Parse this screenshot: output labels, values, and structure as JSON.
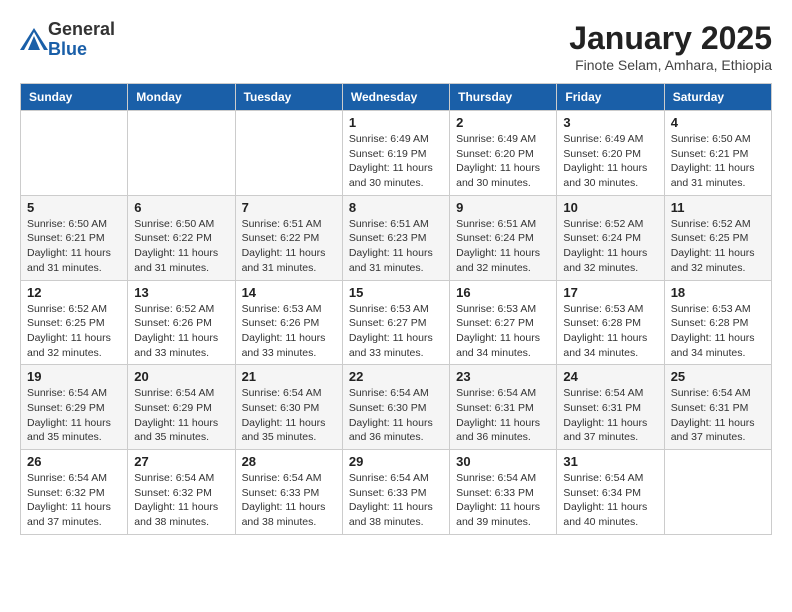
{
  "logo": {
    "general": "General",
    "blue": "Blue"
  },
  "header": {
    "month_title": "January 2025",
    "subtitle": "Finote Selam, Amhara, Ethiopia"
  },
  "weekdays": [
    "Sunday",
    "Monday",
    "Tuesday",
    "Wednesday",
    "Thursday",
    "Friday",
    "Saturday"
  ],
  "weeks": [
    [
      {
        "day": "",
        "info": ""
      },
      {
        "day": "",
        "info": ""
      },
      {
        "day": "",
        "info": ""
      },
      {
        "day": "1",
        "info": "Sunrise: 6:49 AM\nSunset: 6:19 PM\nDaylight: 11 hours\nand 30 minutes."
      },
      {
        "day": "2",
        "info": "Sunrise: 6:49 AM\nSunset: 6:20 PM\nDaylight: 11 hours\nand 30 minutes."
      },
      {
        "day": "3",
        "info": "Sunrise: 6:49 AM\nSunset: 6:20 PM\nDaylight: 11 hours\nand 30 minutes."
      },
      {
        "day": "4",
        "info": "Sunrise: 6:50 AM\nSunset: 6:21 PM\nDaylight: 11 hours\nand 31 minutes."
      }
    ],
    [
      {
        "day": "5",
        "info": "Sunrise: 6:50 AM\nSunset: 6:21 PM\nDaylight: 11 hours\nand 31 minutes."
      },
      {
        "day": "6",
        "info": "Sunrise: 6:50 AM\nSunset: 6:22 PM\nDaylight: 11 hours\nand 31 minutes."
      },
      {
        "day": "7",
        "info": "Sunrise: 6:51 AM\nSunset: 6:22 PM\nDaylight: 11 hours\nand 31 minutes."
      },
      {
        "day": "8",
        "info": "Sunrise: 6:51 AM\nSunset: 6:23 PM\nDaylight: 11 hours\nand 31 minutes."
      },
      {
        "day": "9",
        "info": "Sunrise: 6:51 AM\nSunset: 6:24 PM\nDaylight: 11 hours\nand 32 minutes."
      },
      {
        "day": "10",
        "info": "Sunrise: 6:52 AM\nSunset: 6:24 PM\nDaylight: 11 hours\nand 32 minutes."
      },
      {
        "day": "11",
        "info": "Sunrise: 6:52 AM\nSunset: 6:25 PM\nDaylight: 11 hours\nand 32 minutes."
      }
    ],
    [
      {
        "day": "12",
        "info": "Sunrise: 6:52 AM\nSunset: 6:25 PM\nDaylight: 11 hours\nand 32 minutes."
      },
      {
        "day": "13",
        "info": "Sunrise: 6:52 AM\nSunset: 6:26 PM\nDaylight: 11 hours\nand 33 minutes."
      },
      {
        "day": "14",
        "info": "Sunrise: 6:53 AM\nSunset: 6:26 PM\nDaylight: 11 hours\nand 33 minutes."
      },
      {
        "day": "15",
        "info": "Sunrise: 6:53 AM\nSunset: 6:27 PM\nDaylight: 11 hours\nand 33 minutes."
      },
      {
        "day": "16",
        "info": "Sunrise: 6:53 AM\nSunset: 6:27 PM\nDaylight: 11 hours\nand 34 minutes."
      },
      {
        "day": "17",
        "info": "Sunrise: 6:53 AM\nSunset: 6:28 PM\nDaylight: 11 hours\nand 34 minutes."
      },
      {
        "day": "18",
        "info": "Sunrise: 6:53 AM\nSunset: 6:28 PM\nDaylight: 11 hours\nand 34 minutes."
      }
    ],
    [
      {
        "day": "19",
        "info": "Sunrise: 6:54 AM\nSunset: 6:29 PM\nDaylight: 11 hours\nand 35 minutes."
      },
      {
        "day": "20",
        "info": "Sunrise: 6:54 AM\nSunset: 6:29 PM\nDaylight: 11 hours\nand 35 minutes."
      },
      {
        "day": "21",
        "info": "Sunrise: 6:54 AM\nSunset: 6:30 PM\nDaylight: 11 hours\nand 35 minutes."
      },
      {
        "day": "22",
        "info": "Sunrise: 6:54 AM\nSunset: 6:30 PM\nDaylight: 11 hours\nand 36 minutes."
      },
      {
        "day": "23",
        "info": "Sunrise: 6:54 AM\nSunset: 6:31 PM\nDaylight: 11 hours\nand 36 minutes."
      },
      {
        "day": "24",
        "info": "Sunrise: 6:54 AM\nSunset: 6:31 PM\nDaylight: 11 hours\nand 37 minutes."
      },
      {
        "day": "25",
        "info": "Sunrise: 6:54 AM\nSunset: 6:31 PM\nDaylight: 11 hours\nand 37 minutes."
      }
    ],
    [
      {
        "day": "26",
        "info": "Sunrise: 6:54 AM\nSunset: 6:32 PM\nDaylight: 11 hours\nand 37 minutes."
      },
      {
        "day": "27",
        "info": "Sunrise: 6:54 AM\nSunset: 6:32 PM\nDaylight: 11 hours\nand 38 minutes."
      },
      {
        "day": "28",
        "info": "Sunrise: 6:54 AM\nSunset: 6:33 PM\nDaylight: 11 hours\nand 38 minutes."
      },
      {
        "day": "29",
        "info": "Sunrise: 6:54 AM\nSunset: 6:33 PM\nDaylight: 11 hours\nand 38 minutes."
      },
      {
        "day": "30",
        "info": "Sunrise: 6:54 AM\nSunset: 6:33 PM\nDaylight: 11 hours\nand 39 minutes."
      },
      {
        "day": "31",
        "info": "Sunrise: 6:54 AM\nSunset: 6:34 PM\nDaylight: 11 hours\nand 40 minutes."
      },
      {
        "day": "",
        "info": ""
      }
    ]
  ]
}
